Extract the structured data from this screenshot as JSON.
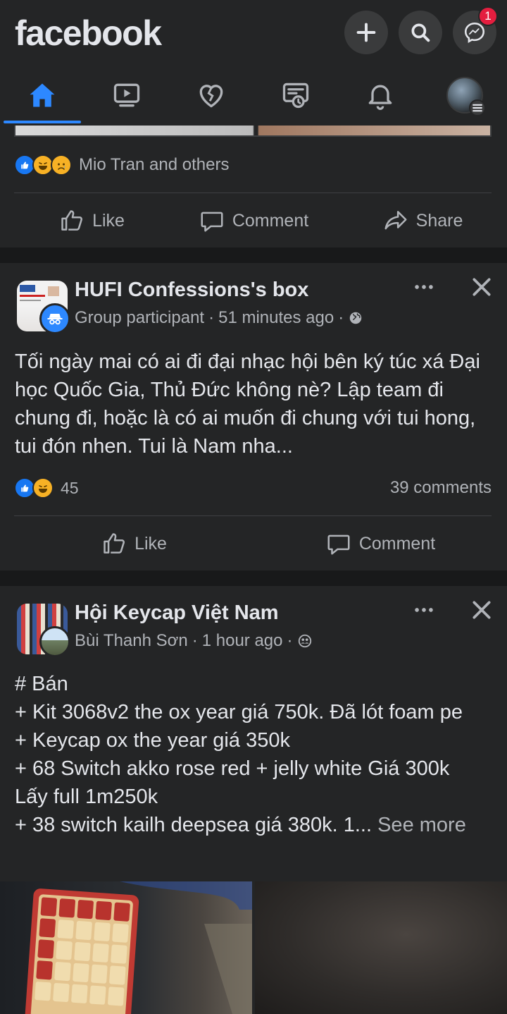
{
  "app": {
    "logo": "facebook"
  },
  "header": {
    "actions": [
      {
        "icon": "plus-icon"
      },
      {
        "icon": "search-icon"
      },
      {
        "icon": "messenger-icon",
        "badge": "1"
      }
    ],
    "tabs": [
      {
        "name": "home",
        "icon": "home-icon",
        "active": true
      },
      {
        "name": "watch",
        "icon": "video-icon"
      },
      {
        "name": "dating",
        "icon": "heart-icon"
      },
      {
        "name": "memories",
        "icon": "memories-icon"
      },
      {
        "name": "notifications",
        "icon": "bell-icon"
      },
      {
        "name": "menu",
        "icon": "profile-avatar"
      }
    ],
    "accent_color": "#2d88ff",
    "badge_color": "#e41e3f"
  },
  "post0": {
    "reactions_text": "Mio Tran and others",
    "reactions": [
      "like",
      "haha",
      "sad"
    ],
    "actions": {
      "like": "Like",
      "comment": "Comment",
      "share": "Share"
    }
  },
  "post1": {
    "group": "HUFI Confessions's box",
    "author_role": "Group participant",
    "time": "51 minutes ago",
    "privacy_icon": "globe-icon",
    "body": "Tối ngày mai có ai đi đại nhạc hội bên ký túc xá Đại học Quốc Gia, Thủ Đức không nè? Lập team đi chung đi, hoặc là có ai muốn đi chung với tui hong, tui đón nhen. Tui là Nam nha...",
    "reactions": [
      "like",
      "haha"
    ],
    "reaction_count": "45",
    "comments": "39 comments",
    "actions": {
      "like": "Like",
      "comment": "Comment"
    }
  },
  "post2": {
    "group": "Hội Keycap Việt Nam",
    "author": "Bùi Thanh Sơn",
    "time": "1 hour ago",
    "privacy_icon": "members-icon",
    "body_lines": [
      "# Bán",
      "+ Kit 3068v2 the ox year giá 750k. Đã lót foam pe",
      "+ Keycap ox the year giá 350k",
      "+ 68 Switch akko rose red + jelly white Giá 300k Lấy full 1m250k",
      "+ 38 switch kailh deepsea giá 380k. 1..."
    ],
    "see_more": "See more"
  },
  "separator": "·"
}
